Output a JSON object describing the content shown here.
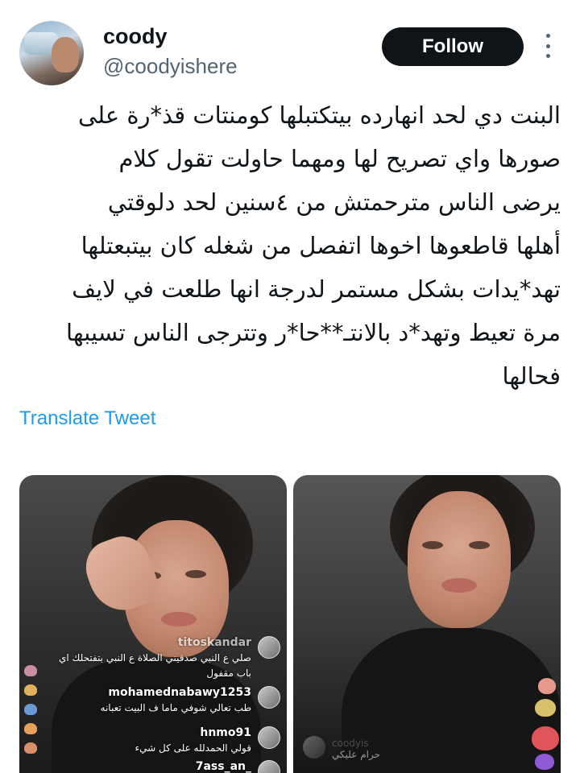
{
  "user": {
    "name": "coody",
    "handle": "@coodyishere"
  },
  "header": {
    "follow_label": "Follow"
  },
  "tweet": {
    "lines": [
      "البنت دي لحد انهارده بيتكتبلها كومنتات قذ*رة على",
      "صورها واي تصريح لها ومهما حاولت تقول كلام",
      "يرضى الناس مترحمتش من ٤سنين لحد دلوقتي",
      "أهلها قاطعوها اخوها اتفصل من شغله كان بيتبعتلها",
      "تهد*يدات بشكل مستمر لدرجة انها طلعت في لايف",
      "مرة تعيط وتهد*د بالانتـ**حا*ر وتترجى الناس تسيبها",
      "فحالها"
    ],
    "translate_label": "Translate Tweet"
  },
  "media": {
    "left_photo": {
      "comments": [
        {
          "user": "titoskandar",
          "text_lines": [
            "صلي ع النبي صدقيني الصلاة ع النبي بتفتحلك اي",
            "باب مقفول"
          ]
        },
        {
          "user": "mohamednabawy1253",
          "text_lines": [
            "طب تعالي شوفي ماما ف البيت تعبانه"
          ]
        },
        {
          "user": "hnmo91",
          "text_lines": [
            "قولي الحمدلله على كل شيء"
          ]
        },
        {
          "user": "7ass_an_",
          "text_lines": []
        }
      ]
    },
    "right_photo": {
      "watermark_user": "coodyis",
      "watermark_text": "حرام عليكي"
    }
  },
  "colors": {
    "follow_bg": "#0f1419",
    "link": "#1d9bf0",
    "secondary_text": "#536471"
  },
  "icons": {
    "more": "more-vertical-icon"
  }
}
